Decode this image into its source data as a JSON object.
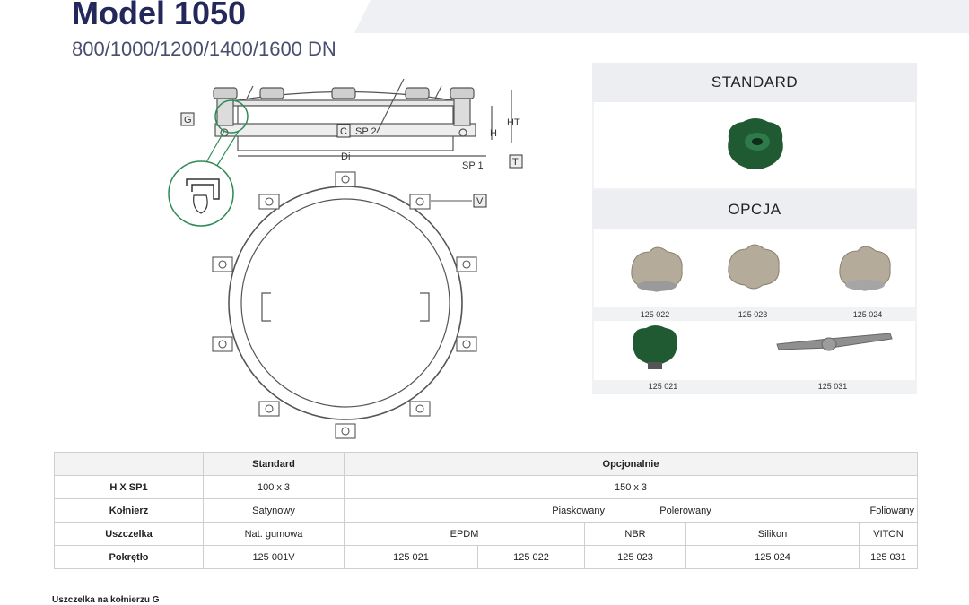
{
  "header": {
    "title": "Model 1050",
    "subtitle": "800/1000/1200/1400/1600 DN"
  },
  "drawing": {
    "labels": {
      "g": "G",
      "c": "C",
      "sp2": "SP 2",
      "di": "Di",
      "sp1": "SP 1",
      "t": "T",
      "h": "H",
      "ht": "HT",
      "v": "V"
    }
  },
  "options_panel": {
    "standard_label": "STANDARD",
    "option_label": "OPCJA",
    "codes": [
      "125 022",
      "125 023",
      "125 024",
      "125 021",
      "125 031"
    ]
  },
  "spec_table": {
    "header": [
      "",
      "Standard",
      "Opcjonalnie"
    ],
    "hxsp1": {
      "label": "H X SP1",
      "standard": "100 x 3",
      "optional": "150 x 3"
    },
    "kolnierz": {
      "label": "Kołnierz",
      "standard": "Satynowy",
      "options": [
        "Piaskowany",
        "Polerowany",
        "Foliowany"
      ]
    },
    "uszczelka": {
      "label": "Uszczelka",
      "standard": "Nat. gumowa",
      "options": [
        "EPDM",
        "NBR",
        "Silikon",
        "VITON"
      ]
    },
    "pokretlo": {
      "label": "Pokrętło",
      "standard": "125 001V",
      "options": [
        "125 021",
        "125 022",
        "125 023",
        "125 024",
        "125 031"
      ]
    }
  },
  "footnote": "Uszczelka na kołnierzu G",
  "colors": {
    "title": "#23275a",
    "accent_green": "#2e8b57",
    "knob_green": "#1f5a33"
  }
}
